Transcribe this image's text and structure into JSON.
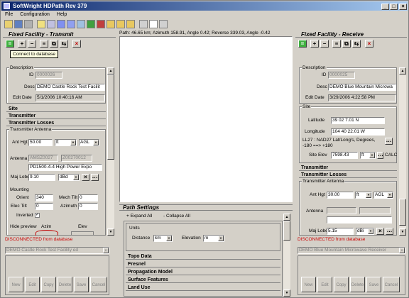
{
  "window": {
    "title": "SoftWright HDPath Rev 379"
  },
  "menu": [
    "File",
    "Configuration",
    "Help"
  ],
  "toolbar": {
    "icons": [
      "open-icon",
      "save-icon",
      "print-icon",
      "sep",
      "edit-icon",
      "cut-icon",
      "copy-icon",
      "paste-icon",
      "map-icon",
      "chart-icon",
      "folder-icon",
      "folder-icon",
      "folder-icon",
      "folder-icon",
      "zoom-icon",
      "page-icon",
      "list-icon"
    ]
  },
  "left": {
    "title": "Fixed Facility - Transmit",
    "tooltip": "Connect to database",
    "description_label": "Description",
    "id_label": "ID",
    "id_value": "0000026",
    "desc_label": "Desc",
    "desc_value": "DEMO Castle Rock Test Facilit",
    "editdate_label": "Edit Date",
    "editdate_value": "5/1/2006 10:40:16 AM",
    "sec_site": "Site",
    "sec_transmitter": "Transmitter",
    "sec_losses": "Transmitter Losses",
    "antenna_group": "Transmitter Antenna",
    "anthgt_label": "Ant Hgt",
    "anthgt_value": "50.00",
    "anthgt_unit": "ft",
    "anthgt_ref": "AGL",
    "antenna_label": "Antenna",
    "antenna_mfr": "AMSZ0027",
    "antenna_code": "Z00270012",
    "antenna_model": "PD1500-4-4 High Power Expo",
    "majlobe_label": "Maj Lobe",
    "majlobe_value": "9.10",
    "majlobe_unit": "dBd",
    "mounting_label": "Mounting",
    "orient_label": "Orient",
    "orient_value": "340",
    "mechtilt_label": "Mech Tilt",
    "mechtilt_value": "0",
    "electilt_label": "Elec Tilt",
    "electilt_value": "0",
    "azimuth_label": "Azimuth",
    "azimuth_value": "0",
    "inverted_label": "Inverted",
    "hidepreview_label": "Hide preview",
    "azim_label": "Azim",
    "elev_label": "Elev",
    "status": "DISCONNECTED  from database",
    "selected": "DEMO Castle Rock Test Facility ed",
    "buttons": [
      "New",
      "Edit",
      "Copy",
      "Delete",
      "Save",
      "Cancel"
    ]
  },
  "center": {
    "path_info": "Path: 46.65 km; Azimuth 158.91, Angle 0.42; Reverse 339.03, Angle -0.42",
    "settings_title": "Path Settings",
    "expand_all": "+ Expand All",
    "collapse_all": "- Collapse All",
    "units_label": "Units",
    "distance_label": "Distance",
    "distance_value": "km",
    "elevation_label": "Elevation",
    "elevation_value": "m",
    "sections": [
      "Topo Data",
      "Fresnel",
      "Propagation Model",
      "Surface Features",
      "Land Use"
    ]
  },
  "right": {
    "title": "Fixed Facility - Receive",
    "description_label": "Description",
    "id_label": "ID",
    "id_value": "0000025",
    "desc_label": "Desc",
    "desc_value": "DEMO Blue Mountain Microwa",
    "editdate_label": "Edit Date",
    "editdate_value": "3/29/2006 4:22:58 PM",
    "site_label": "Site",
    "lat_label": "Latitude",
    "lat_value": "39 02 7.01 N",
    "lon_label": "Longitude",
    "lon_value": "104 40 22.01 W",
    "datum_text": "LL27 : NAD27 Lat/Long's, Degrees, -180 ==> +180",
    "siteelev_label": "Site Elev",
    "siteelev_value": "7598.43",
    "siteelev_unit": "ft",
    "calc_label": "CALC",
    "sec_transmitter": "Transmitter",
    "sec_losses": "Transmitter Losses",
    "antenna_group": "Transmitter Antenna",
    "anthgt_label": "Ant Hgt",
    "anthgt_value": "30.00",
    "anthgt_unit": "ft",
    "anthgt_ref": "AGL",
    "antenna_label": "Antenna",
    "majlobe_label": "Maj Lobe",
    "majlobe_value": "5.15",
    "majlobe_unit": "dBi",
    "status": "DISCONNECTED  from database",
    "selected": "DEMO Blue Mountain Microwave Receiver",
    "buttons": [
      "New",
      "Edit",
      "Copy",
      "Delete",
      "Save",
      "Cancel"
    ]
  }
}
